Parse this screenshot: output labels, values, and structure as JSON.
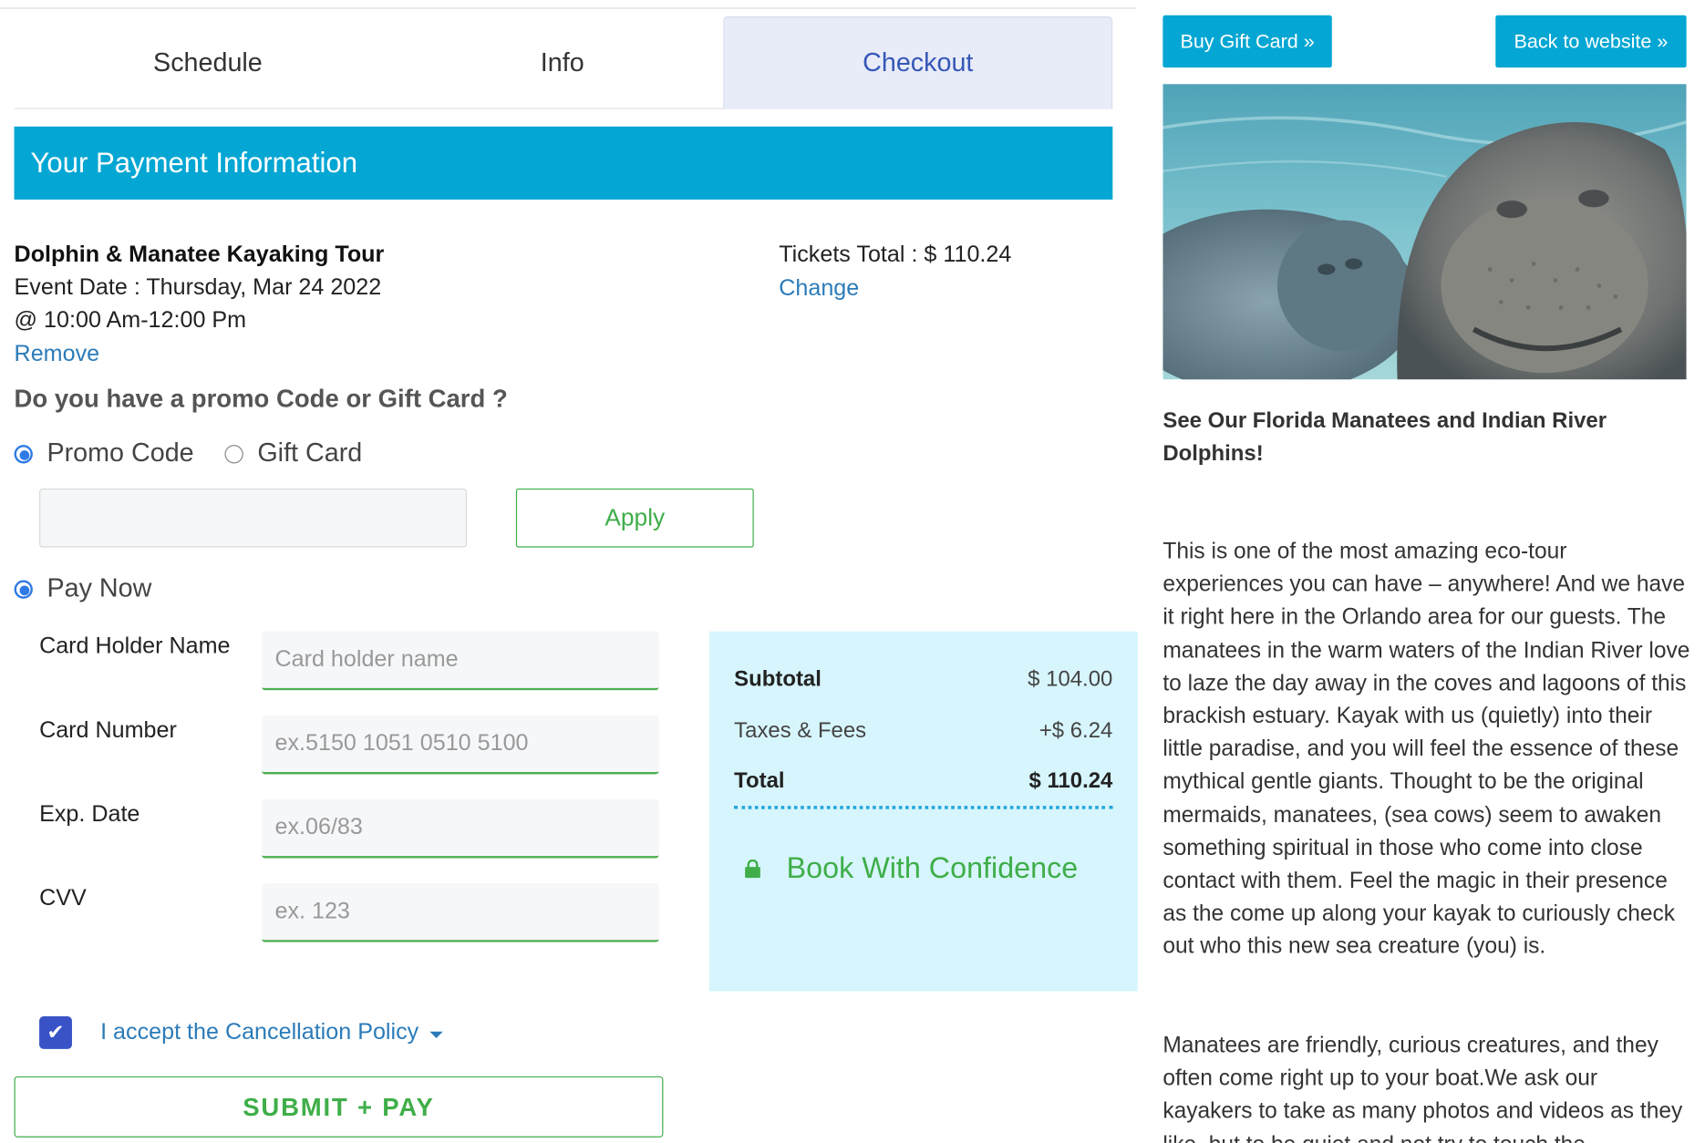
{
  "tabs": [
    "Schedule",
    "Info",
    "Checkout"
  ],
  "payment_header": "Your Payment Information",
  "tour": {
    "name": "Dolphin & Manatee Kayaking Tour",
    "event_date": "Event Date : Thursday, Mar 24 2022",
    "time": "@ 10:00 Am-12:00 Pm",
    "remove_label": "Remove",
    "tickets_total": "Tickets Total : $ 110.24",
    "change_label": "Change"
  },
  "promo": {
    "question": "Do you have a promo Code or Gift Card ?",
    "option_promo": "Promo Code",
    "option_gift": "Gift Card",
    "selected": "Promo Code",
    "input_value": "",
    "apply_label": "Apply"
  },
  "pay_now_label": "Pay Now",
  "card_fields": {
    "holder_label": "Card Holder Name",
    "holder_placeholder": "Card holder name",
    "number_label": "Card Number",
    "number_placeholder": "ex.5150 1051 0510 5100",
    "exp_label": "Exp. Date",
    "exp_placeholder": "ex.06/83",
    "cvv_label": "CVV",
    "cvv_placeholder": "ex. 123"
  },
  "summary": {
    "subtotal_label": "Subtotal",
    "subtotal_value": "$ 104.00",
    "taxes_label": "Taxes & Fees",
    "taxes_value": "+$ 6.24",
    "total_label": "Total",
    "total_value": "$ 110.24",
    "confidence": "Book With Confidence"
  },
  "cancellation": {
    "checked": true,
    "label": "I accept the Cancellation Policy"
  },
  "submit_label": "SUBMIT + PAY",
  "sidebar": {
    "buy_gift_card": "Buy Gift Card »",
    "back_to_website": "Back to website »",
    "title": "See Our Florida Manatees and Indian River Dolphins!",
    "paragraph1": "This is one of the most amazing eco-tour experiences you can have – anywhere! And we have it right here in the Orlando area for our guests. The manatees in the warm waters of the Indian River love to laze the day away in the coves and lagoons of this brackish estuary. Kayak with us (quietly) into their little paradise, and you will feel the essence of these mythical gentle giants. Thought to be the original mermaids, manatees, (sea cows) seem to awaken something spiritual in those who come into close contact with them. Feel the magic in their presence as the come up along your kayak to curiously check out who this new sea creature (you) is.",
    "paragraph2": "Manatees are friendly, curious creatures, and they often come right up to your boat.We ask our kayakers to take as many photos and videos as they like, but to be quiet and not try to touch the"
  },
  "colors": {
    "accent": "#04a6d3",
    "green": "#3fae49",
    "link": "#2b7bb9",
    "summary_bg": "#d7f5fd",
    "checkbox": "#3953c7"
  }
}
